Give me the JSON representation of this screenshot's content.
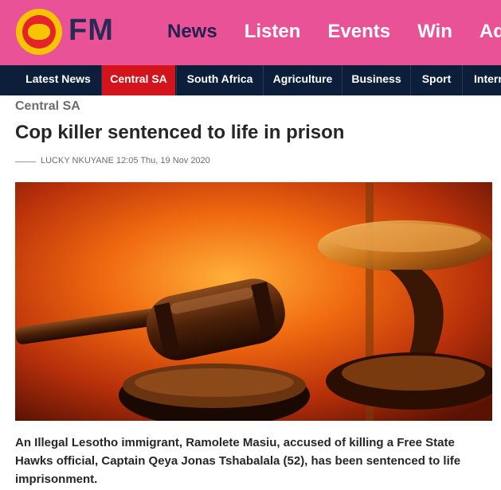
{
  "brand": {
    "logo_text": "FM"
  },
  "main_nav": {
    "items": [
      "News",
      "Listen",
      "Events",
      "Win",
      "Adv"
    ]
  },
  "sub_nav": {
    "items": [
      "Latest News",
      "Central SA",
      "South Africa",
      "Agriculture",
      "Business",
      "Sport",
      "Intern"
    ],
    "current": "Central SA"
  },
  "article": {
    "category": "Central SA",
    "headline": "Cop killer sentenced to life in prison",
    "byline": "LUCKY NKUYANE 12:05 Thu, 19 Nov 2020",
    "image_alt": "gavel-and-scales-image",
    "body": "An Illegal Lesotho immigrant, Ramolete Masiu, accused of killing a Free State Hawks official, Captain Qeya Jonas Tshabalala (52), has been sentenced to life imprisonment."
  },
  "colors": {
    "header_pink": "#ea5297",
    "nav_navy": "#0d1e3a",
    "current_red": "#d3141c",
    "logo_yellow": "#f6c400",
    "logo_red": "#e5232a"
  }
}
